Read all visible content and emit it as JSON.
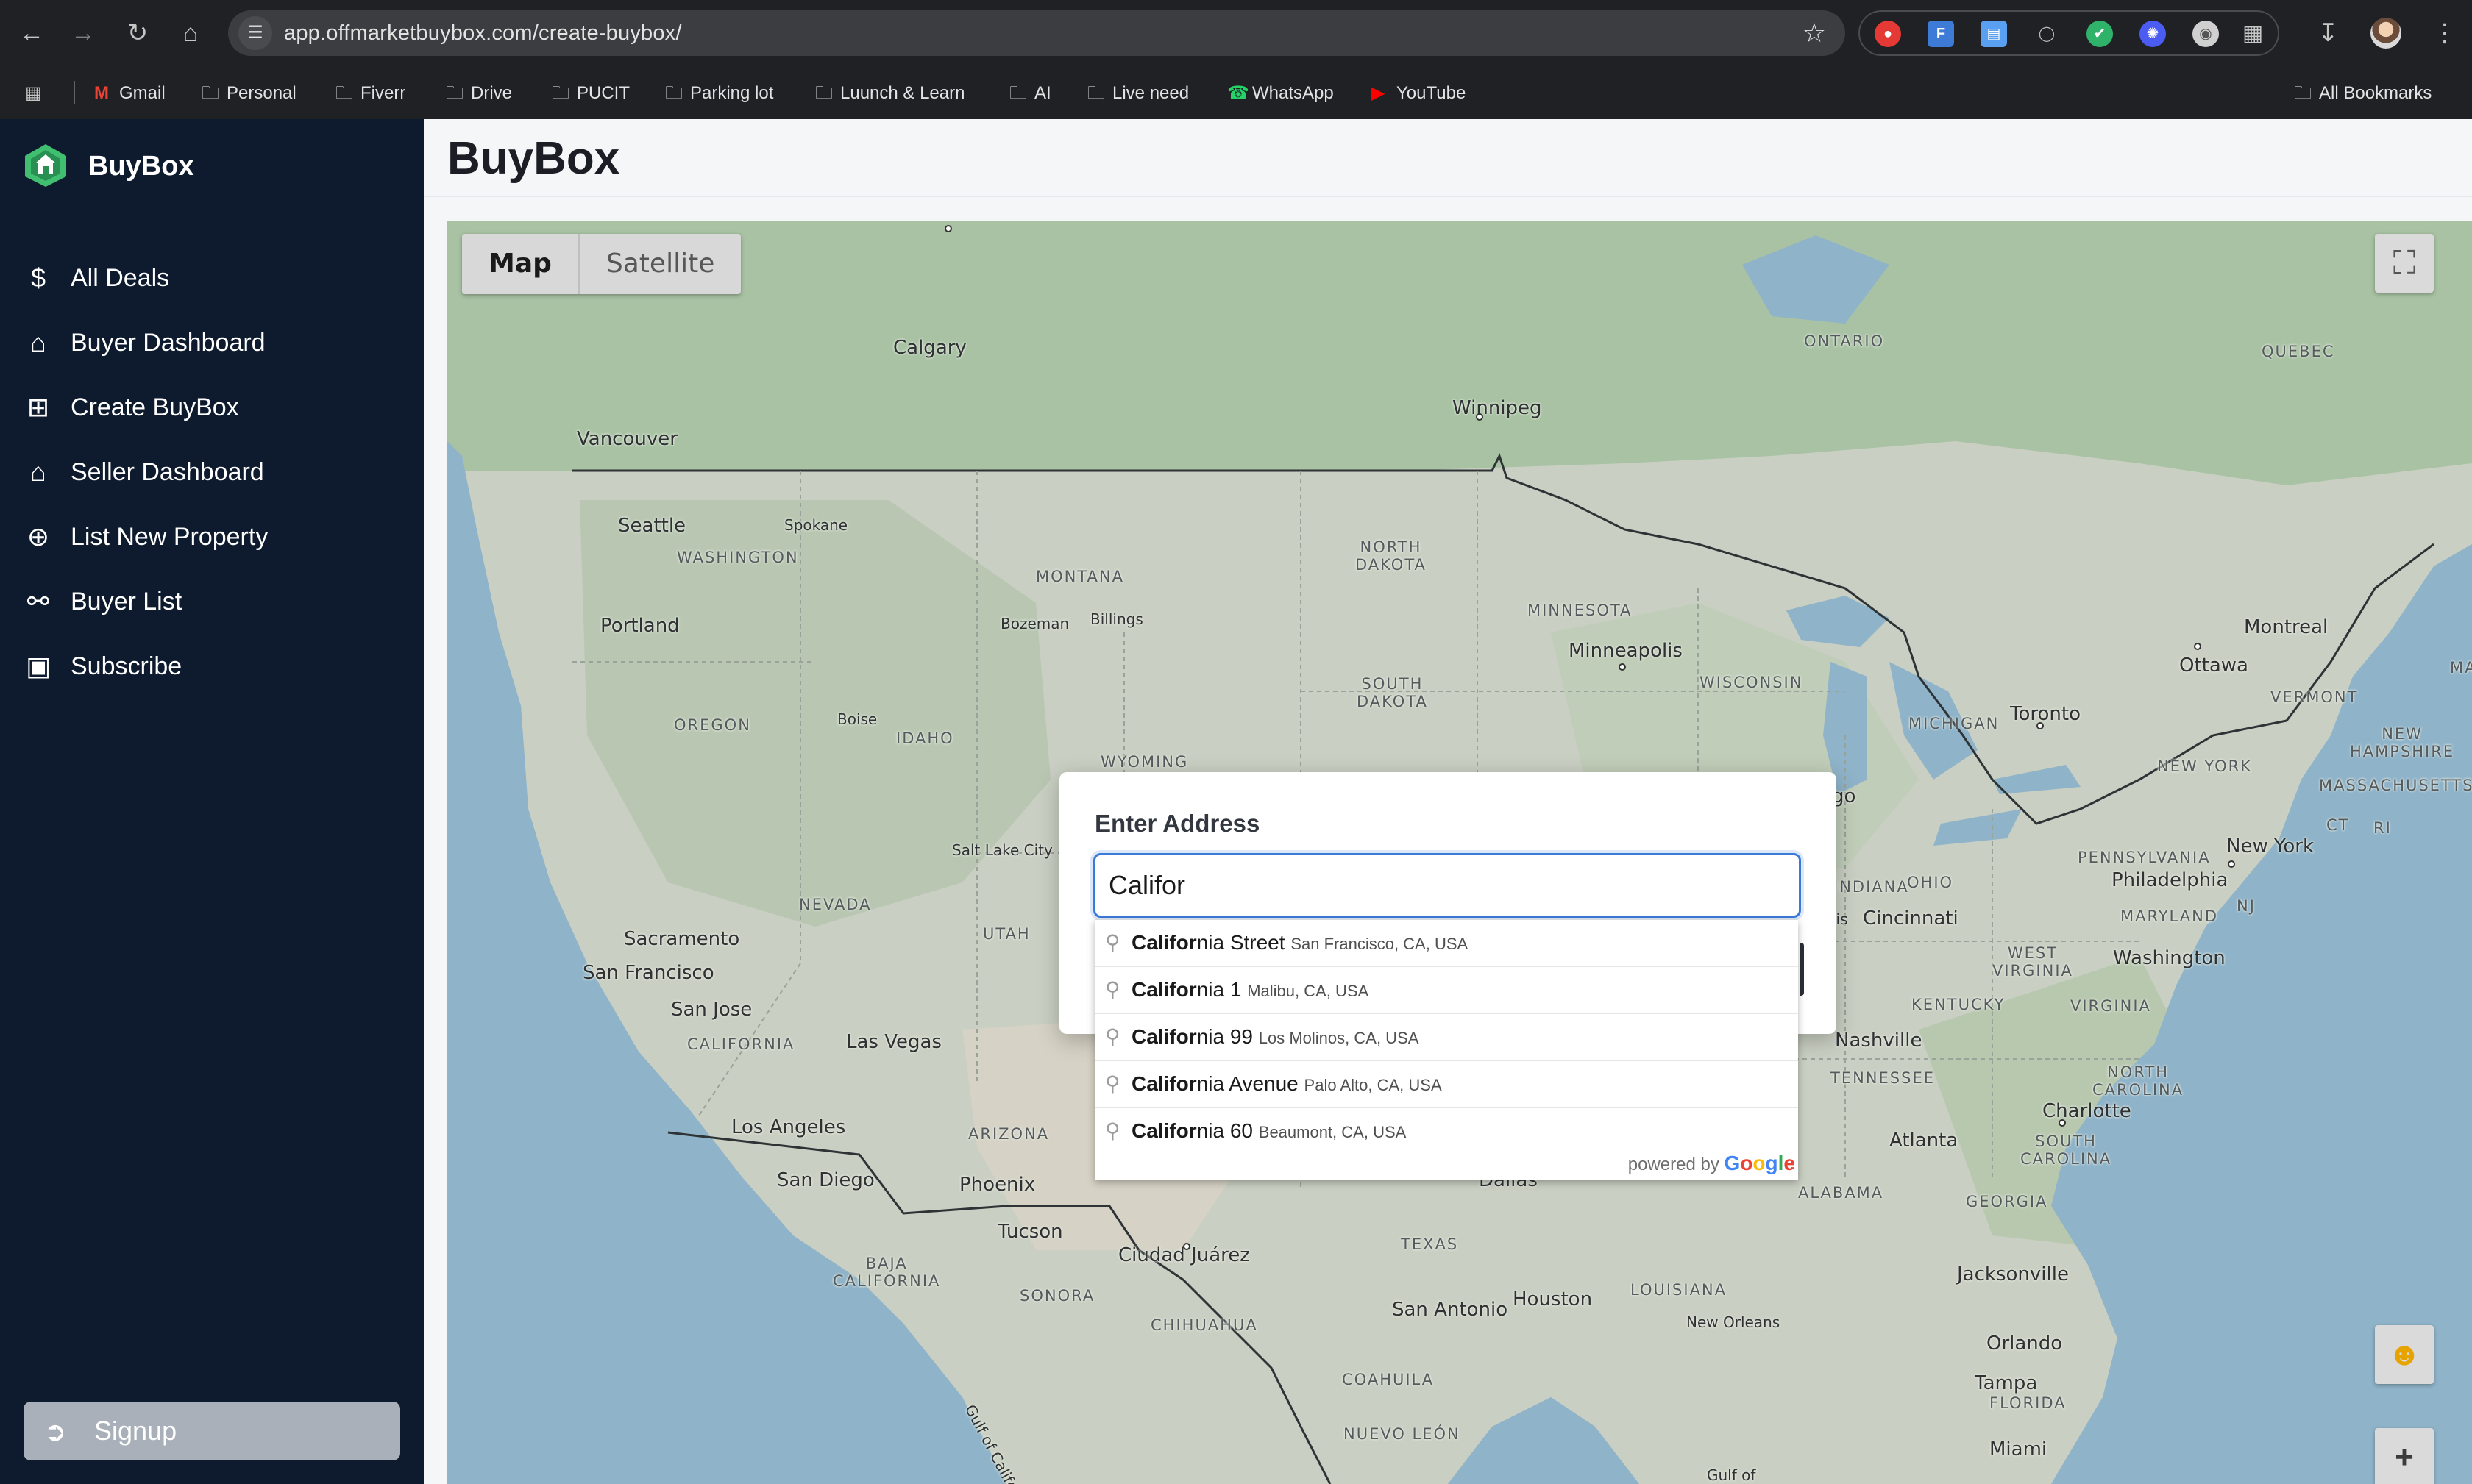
{
  "browser": {
    "url": "app.offmarketbuybox.com/create-buybox/",
    "bookmarks": [
      {
        "label": "Gmail",
        "icon": "gmail-icon"
      },
      {
        "label": "Personal",
        "icon": "folder-icon"
      },
      {
        "label": "Fiverr",
        "icon": "folder-icon"
      },
      {
        "label": "Drive",
        "icon": "folder-icon"
      },
      {
        "label": "PUCIT",
        "icon": "folder-icon"
      },
      {
        "label": "Parking lot",
        "icon": "folder-icon"
      },
      {
        "label": "Luunch & Learn",
        "icon": "folder-icon"
      },
      {
        "label": "AI",
        "icon": "folder-icon"
      },
      {
        "label": "Live need",
        "icon": "folder-icon"
      },
      {
        "label": "WhatsApp",
        "icon": "whatsapp-icon"
      },
      {
        "label": "YouTube",
        "icon": "youtube-icon"
      }
    ],
    "all_bookmarks": "All Bookmarks"
  },
  "sidebar": {
    "brand": "BuyBox",
    "items": [
      {
        "label": "All Deals",
        "icon": "dollar-icon"
      },
      {
        "label": "Buyer Dashboard",
        "icon": "home-icon"
      },
      {
        "label": "Create BuyBox",
        "icon": "plus-square-icon"
      },
      {
        "label": "Seller Dashboard",
        "icon": "home-icon"
      },
      {
        "label": "List New Property",
        "icon": "plus-circle-icon"
      },
      {
        "label": "Buyer List",
        "icon": "users-icon"
      },
      {
        "label": "Subscribe",
        "icon": "credit-card-icon"
      }
    ],
    "signup": "Signup"
  },
  "main": {
    "title": "BuyBox"
  },
  "map": {
    "map_type": {
      "map": "Map",
      "satellite": "Satellite",
      "selected": "Map"
    },
    "labels": {
      "calgary": "Calgary",
      "vancouver": "Vancouver",
      "seattle": "Seattle",
      "spokane": "Spokane",
      "washington": "WASHINGTON",
      "portland": "Portland",
      "oregon": "OREGON",
      "boise": "Boise",
      "idaho": "IDAHO",
      "montana": "MONTANA",
      "bozeman": "Bozeman",
      "billings": "Billings",
      "wyoming": "WYOMING",
      "nevada": "NEVADA",
      "salt_lake_city": "Salt Lake City",
      "utah": "UTAH",
      "sacramento": "Sacramento",
      "san_francisco": "San Francisco",
      "san_jose": "San Jose",
      "california": "CALIFORNIA",
      "las_vegas": "Las Vegas",
      "los_angeles": "Los Angeles",
      "san_diego": "San Diego",
      "arizona": "ARIZONA",
      "phoenix": "Phoenix",
      "tucson": "Tucson",
      "ciudad_juarez": "Ciudad Juárez",
      "baja_california": "BAJA\nCALIFORNIA",
      "sonora": "SONORA",
      "chihuahua": "CHIHUAHUA",
      "coahuila": "COAHUILA",
      "nuevo_leon": "NUEVO LEÓN",
      "gulf_of_california": "Gulf of California",
      "texas": "TEXAS",
      "san_antonio": "San Antonio",
      "houston": "Houston",
      "dallas": "Dallas",
      "louisiana": "LOUISIANA",
      "new_orleans": "New Orleans",
      "winnipeg": "Winnipeg",
      "ontario": "ONTARIO",
      "quebec": "QUEBEC",
      "north_dakota": "NORTH\nDAKOTA",
      "south_dakota": "SOUTH\nDAKOTA",
      "minnesota": "MINNESOTA",
      "minneapolis": "Minneapolis",
      "wisconsin": "WISCONSIN",
      "michigan": "MICHIGAN",
      "toronto": "Toronto",
      "ottawa": "Ottawa",
      "montreal": "Montreal",
      "vermont": "VERMONT",
      "new_hampshire": "NEW\nHAMPSHIRE",
      "massachusetts": "MASSACHUSETTS",
      "new_york_state": "NEW YORK",
      "new_york": "New York",
      "ct": "CT",
      "ri": "RI",
      "main": "MAIN",
      "pennsylvania": "PENNSYLVANIA",
      "philadelphia": "Philadelphia",
      "nj": "NJ",
      "maryland": "MARYLAND",
      "washington_dc": "Washington",
      "west_virginia": "WEST\nVIRGINIA",
      "virginia": "VIRGINIA",
      "ohio": "OHIO",
      "indiana": "INDIANA",
      "cincinnati": "Cincinnati",
      "kentucky": "KENTUCKY",
      "tennessee": "TENNESSEE",
      "nashville": "Nashville",
      "north_carolina": "NORTH\nCAROLINA",
      "charlotte": "Charlotte",
      "south_carolina": "SOUTH\nCAROLINA",
      "atlanta": "Atlanta",
      "georgia": "GEORGIA",
      "alabama": "ALABAMA",
      "jacksonville": "Jacksonville",
      "orlando": "Orlando",
      "tampa": "Tampa",
      "florida": "FLORIDA",
      "miami": "Miami",
      "gulf_of": "Gulf of",
      "lis": "lis",
      "go": "go"
    }
  },
  "modal": {
    "title": "Enter Address",
    "input_value": "Califor",
    "suggestions": [
      {
        "match": "Califor",
        "rest": "nia Street",
        "secondary": "San Francisco, CA, USA"
      },
      {
        "match": "Califor",
        "rest": "nia 1",
        "secondary": "Malibu, CA, USA"
      },
      {
        "match": "Califor",
        "rest": "nia 99",
        "secondary": "Los Molinos, CA, USA"
      },
      {
        "match": "Califor",
        "rest": "nia Avenue",
        "secondary": "Palo Alto, CA, USA"
      },
      {
        "match": "Califor",
        "rest": "nia 60",
        "secondary": "Beaumont, CA, USA"
      }
    ],
    "powered_by": "powered by",
    "google": "Google"
  }
}
